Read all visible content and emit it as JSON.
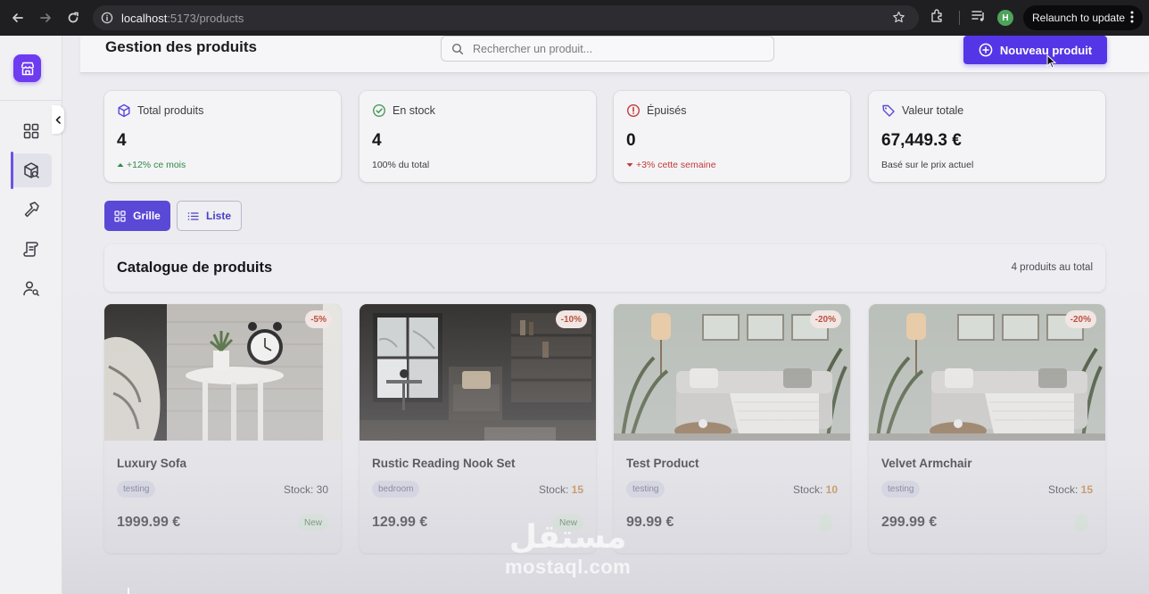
{
  "browser": {
    "url_host": "localhost",
    "url_path": ":5173/products",
    "profile_initial": "H",
    "relaunch_label": "Relaunch to update"
  },
  "header": {
    "title": "Gestion des produits",
    "search_placeholder": "Rechercher un produit...",
    "new_button": "Nouveau produit"
  },
  "sidebar": {
    "items": [
      {
        "icon": "dashboard-icon"
      },
      {
        "icon": "products-box-icon",
        "active": true
      },
      {
        "icon": "hammer-icon"
      },
      {
        "icon": "scroll-icon"
      },
      {
        "icon": "user-search-icon"
      }
    ]
  },
  "stats": [
    {
      "label": "Total produits",
      "value": "4",
      "sub": "+12% ce mois",
      "trend": "up",
      "icon": "cube-icon"
    },
    {
      "label": "En stock",
      "value": "4",
      "sub": "100% du total",
      "trend": "none",
      "icon": "check-circle-icon"
    },
    {
      "label": "Épuisés",
      "value": "0",
      "sub": "+3% cette semaine",
      "trend": "down",
      "icon": "alert-circle-icon"
    },
    {
      "label": "Valeur totale",
      "value": "67,449.3 €",
      "sub": "Basé sur le prix actuel",
      "trend": "none",
      "icon": "tag-icon"
    }
  ],
  "view_toggle": {
    "grid_label": "Grille",
    "list_label": "Liste",
    "active": "grid"
  },
  "catalogue": {
    "title": "Catalogue de produits",
    "count_text": "4 produits au total"
  },
  "products": [
    {
      "name": "Luxury Sofa",
      "discount": "-5%",
      "category": "testing",
      "stock_label": "Stock:",
      "stock": "30",
      "price": "1999.99 €",
      "badge": "New"
    },
    {
      "name": "Rustic Reading Nook Set",
      "discount": "-10%",
      "category": "bedroom",
      "stock_label": "Stock:",
      "stock": "15",
      "price": "129.99 €",
      "badge": "New"
    },
    {
      "name": "Test Product",
      "discount": "-20%",
      "category": "testing",
      "stock_label": "Stock:",
      "stock": "10",
      "price": "99.99 €",
      "badge": ""
    },
    {
      "name": "Velvet Armchair",
      "discount": "-20%",
      "category": "testing",
      "stock_label": "Stock:",
      "stock": "15",
      "price": "299.99 €",
      "badge": ""
    }
  ],
  "watermark": {
    "arabic": "مستقل",
    "latin": "mostaql.com"
  },
  "colors": {
    "accent": "#5536e6",
    "up": "#2f8a48",
    "down": "#c43a3a",
    "low_stock": "#c07a2a"
  }
}
